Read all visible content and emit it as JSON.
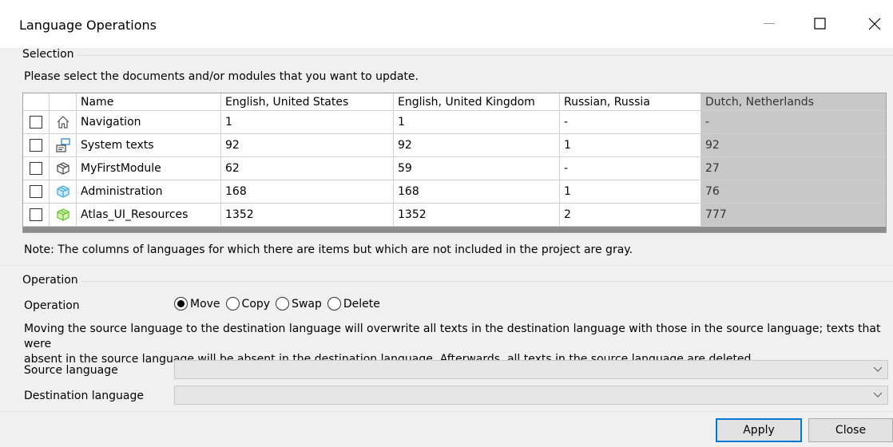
{
  "window": {
    "title": "Language Operations",
    "minimize_icon": "minimize-icon",
    "maximize_icon": "maximize-icon",
    "close_icon": "close-icon"
  },
  "selection": {
    "legend": "Selection",
    "instruction": "Please select the documents and/or modules that you want to update.",
    "columns": [
      "Name",
      "English, United States",
      "English, United Kingdom",
      "Russian, Russia",
      "Dutch, Netherlands"
    ],
    "rows": [
      {
        "name": "Navigation",
        "icon": "home-icon",
        "checked": false,
        "values": [
          "1",
          "1",
          "-",
          "-"
        ]
      },
      {
        "name": "System texts",
        "icon": "system-texts-icon",
        "checked": false,
        "values": [
          "92",
          "92",
          "1",
          "92"
        ]
      },
      {
        "name": "MyFirstModule",
        "icon": "module-icon",
        "checked": false,
        "values": [
          "62",
          "59",
          "-",
          "27"
        ]
      },
      {
        "name": "Administration",
        "icon": "module-blue-icon",
        "checked": false,
        "values": [
          "168",
          "168",
          "1",
          "76"
        ]
      },
      {
        "name": "Atlas_UI_Resources",
        "icon": "module-green-icon",
        "checked": false,
        "values": [
          "1352",
          "1352",
          "2",
          "777"
        ]
      }
    ],
    "note": "Note: The columns of languages for which there are items but which are not included in the project are gray."
  },
  "operation": {
    "legend": "Operation",
    "label": "Operation",
    "options": [
      {
        "label": "Move",
        "selected": true
      },
      {
        "label": "Copy",
        "selected": false
      },
      {
        "label": "Swap",
        "selected": false
      },
      {
        "label": "Delete",
        "selected": false
      }
    ],
    "description_line1": "Moving the source language to the destination language will overwrite all texts in the destination language with those in the source language; texts that were",
    "description_line2": "absent in the source language will be absent in the destination language. Afterwards, all texts in the source language are deleted.",
    "source_label": "Source language",
    "source_value": "",
    "destination_label": "Destination language",
    "destination_value": ""
  },
  "buttons": {
    "apply": "Apply",
    "close": "Close"
  },
  "colors": {
    "gray_column": "#c8c8c8",
    "primary_border": "#0078d7"
  }
}
